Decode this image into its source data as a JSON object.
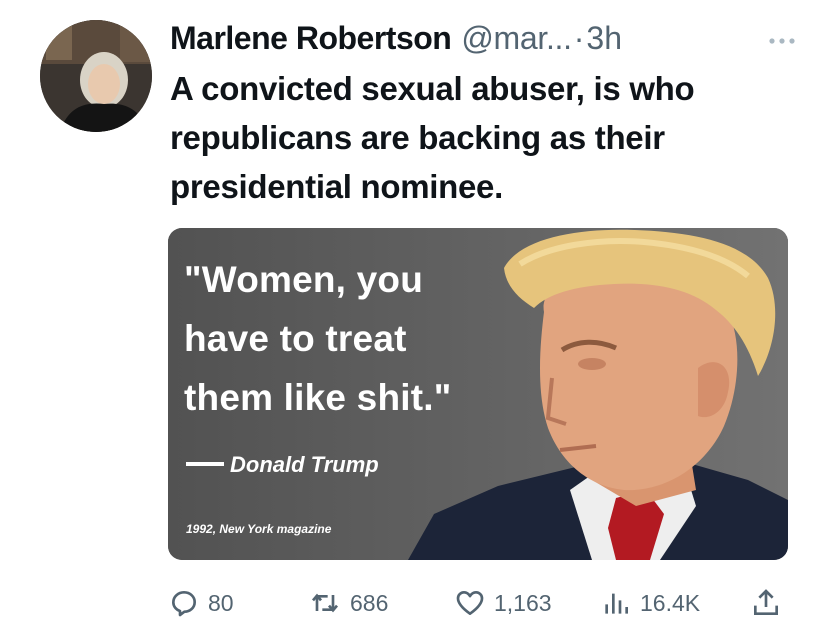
{
  "tweet": {
    "author_name": "Marlene Robertson",
    "author_handle": "@mar...",
    "separator": "·",
    "time": "3h",
    "text": "A convicted sexual abuser, is who republicans are backing as their presidential nominee.",
    "more_icon": "more-horizontal-icon",
    "media": {
      "quote": "\"Women, you have to treat them like shit.\"",
      "attribution": "Donald Trump",
      "source": "1992, New York magazine"
    },
    "actions": {
      "replies": "80",
      "retweets": "686",
      "likes": "1,163",
      "views": "16.4K",
      "reply_icon": "reply-icon",
      "retweet_icon": "retweet-icon",
      "like_icon": "heart-icon",
      "views_icon": "views-icon",
      "share_icon": "share-icon"
    }
  }
}
